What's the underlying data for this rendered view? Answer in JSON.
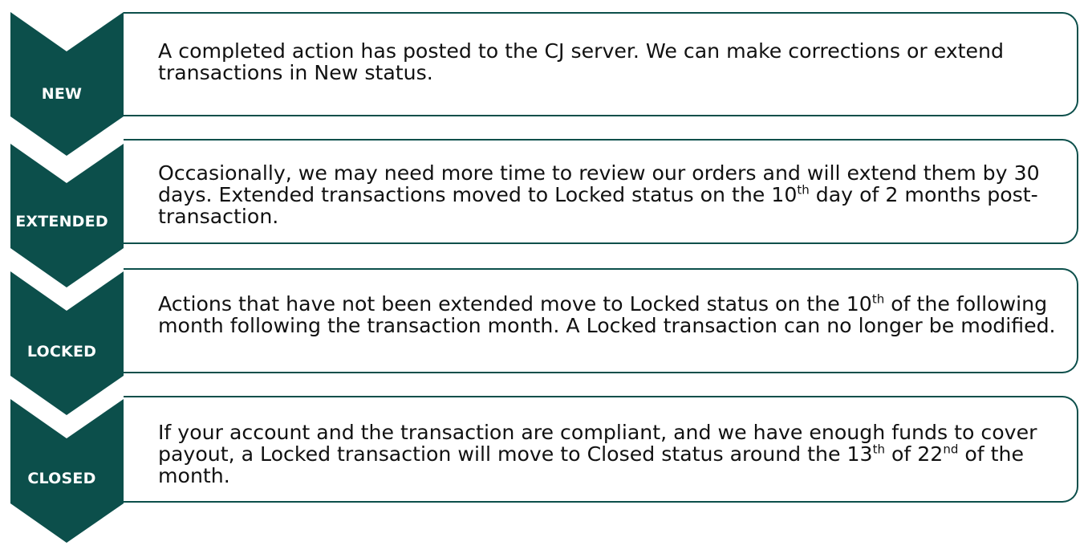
{
  "colors": {
    "chevron": "#0c4f4b",
    "border": "#0c4f4b",
    "label_text": "#ffffff",
    "body_text": "#111111"
  },
  "stages": [
    {
      "label": "NEW",
      "description": [
        "A completed action has posted to the CJ server. We can make corrections or extend transactions in New status."
      ]
    },
    {
      "label": "EXTENDED",
      "description": [
        "Occasionally, we may need more time to review our orders and will extend them by 30 days. Extended transactions moved to Locked status on the 10",
        {
          "sup": "th"
        },
        " day of 2 months post-transaction."
      ]
    },
    {
      "label": "LOCKED",
      "description": [
        "Actions that have not been extended move to Locked status on the 10",
        {
          "sup": "th"
        },
        " of the following month following the transaction month. A Locked transaction can no longer be modified."
      ]
    },
    {
      "label": "CLOSED",
      "description": [
        "If your account and the transaction are compliant, and we have enough funds to cover payout, a Locked transaction will move to Closed status around the 13",
        {
          "sup": "th"
        },
        " of 22",
        {
          "sup": "nd"
        },
        " of the month."
      ]
    }
  ]
}
